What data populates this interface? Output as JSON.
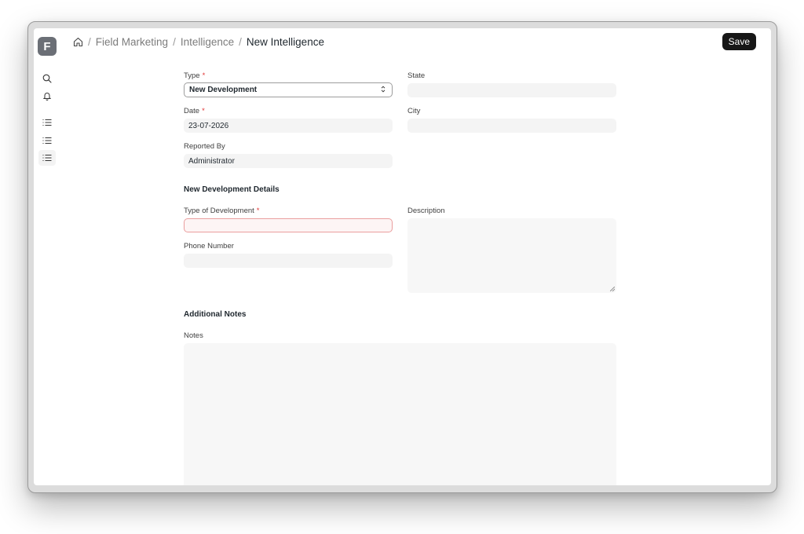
{
  "app": {
    "logo_letter": "F"
  },
  "sidebar": {
    "icons": [
      "search-icon",
      "bell-icon",
      "list-icon",
      "list-icon",
      "list-icon"
    ]
  },
  "breadcrumb": {
    "items": [
      "Field Marketing",
      "Intelligence"
    ],
    "current": "New Intelligence",
    "separator": "/"
  },
  "toolbar": {
    "save_label": "Save"
  },
  "form": {
    "type": {
      "label": "Type",
      "value": "New Development",
      "required": "*"
    },
    "state": {
      "label": "State",
      "value": ""
    },
    "date": {
      "label": "Date",
      "value": "23-07-2026",
      "required": "*"
    },
    "city": {
      "label": "City",
      "value": ""
    },
    "reported_by": {
      "label": "Reported By",
      "value": "Administrator"
    },
    "section_details": "New Development Details",
    "type_of_development": {
      "label": "Type of Development",
      "value": "",
      "required": "*"
    },
    "description": {
      "label": "Description",
      "value": ""
    },
    "phone_number": {
      "label": "Phone Number",
      "value": ""
    },
    "section_notes": "Additional Notes",
    "notes": {
      "label": "Notes",
      "value": ""
    }
  },
  "colors": {
    "accent_dark": "#171717",
    "required": "#e03636",
    "error_border": "#ea9e9e",
    "field_bg": "#f4f4f4"
  }
}
